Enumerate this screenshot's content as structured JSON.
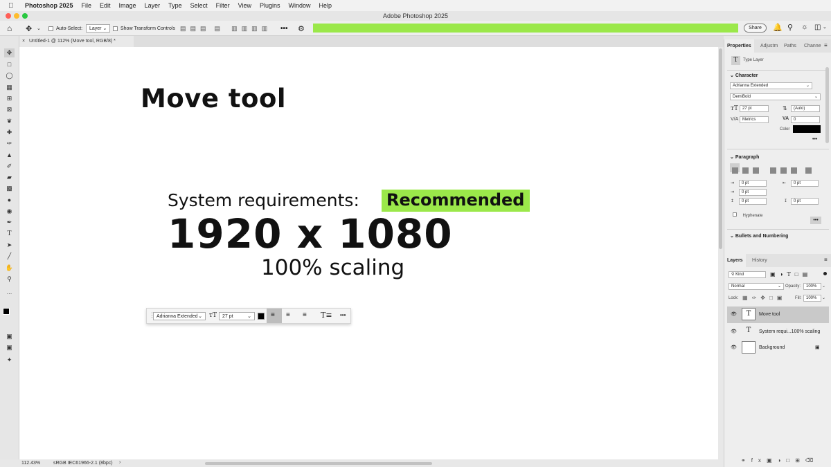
{
  "menubar": {
    "app": "Photoshop 2025",
    "items": [
      "File",
      "Edit",
      "Image",
      "Layer",
      "Type",
      "Select",
      "Filter",
      "View",
      "Plugins",
      "Window",
      "Help"
    ]
  },
  "window": {
    "title": "Adobe Photoshop 2025"
  },
  "options": {
    "auto_select_label": "Auto-Select:",
    "auto_select_value": "Layer",
    "transform_label": "Show Transform Controls",
    "share_label": "Share",
    "progress_color": "#9be84a"
  },
  "document": {
    "tab_title": "Untitled-1 @ 112% (Move tool, RGB/8) *"
  },
  "canvas": {
    "title": "Move tool",
    "sys_req": "System requirements:",
    "recommended": "Recommended",
    "resolution": "1920 x 1080",
    "scaling": "100% scaling",
    "highlight_color": "#9be84a"
  },
  "context_bar": {
    "font": "Adrianna Extended",
    "size": "27 pt"
  },
  "status": {
    "zoom": "112.43%",
    "profile": "sRGB IEC61966-2.1 (8bpc)",
    "arrow": "›"
  },
  "properties": {
    "tabs": [
      "Properties",
      "Adjustm",
      "Paths",
      "Channe"
    ],
    "type_layer": "Type Layer",
    "character_header": "Character",
    "font_family": "Adrianna Extended",
    "font_style": "DemiBold",
    "font_size": "27 pt",
    "leading": "(Auto)",
    "kerning": "Metrics",
    "tracking": "0",
    "color_label": "Color",
    "paragraph_header": "Paragraph",
    "indent_left": "0 pt",
    "indent_right": "0 pt",
    "first_line": "0 pt",
    "space_before": "0 pt",
    "space_after": "0 pt",
    "hyphenate": "Hyphenate",
    "bullets_header": "Bullets and Numbering"
  },
  "layers": {
    "tabs": [
      "Layers",
      "History"
    ],
    "kind": "Kind",
    "blend": "Normal",
    "opacity_label": "Opacity:",
    "opacity": "100%",
    "lock_label": "Lock:",
    "fill_label": "Fill:",
    "fill": "100%",
    "items": [
      {
        "name": "Move tool",
        "thumb": "T"
      },
      {
        "name": "System requi...100% scaling",
        "thumb": "T"
      },
      {
        "name": "Background",
        "thumb": ""
      }
    ]
  }
}
